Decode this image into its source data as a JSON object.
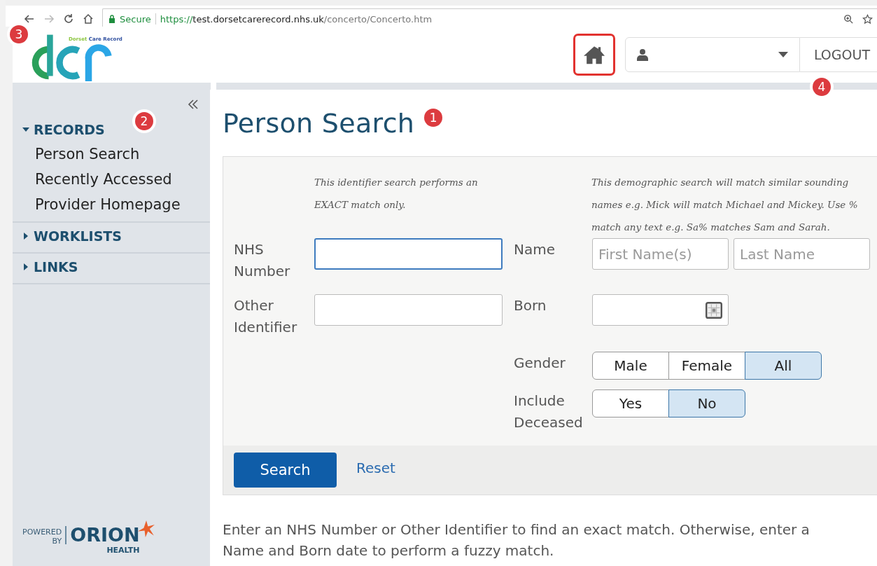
{
  "browser": {
    "secure_label": "Secure",
    "url_scheme": "https://",
    "url_host": "test.dorsetcarerecord.nhs.uk",
    "url_path": "/concerto/Concerto.htm"
  },
  "header": {
    "logo_words": [
      "Dorset",
      "Care Record"
    ],
    "logo_badge": "3",
    "logout": "LOGOUT",
    "logout_badge": "4"
  },
  "sidebar": {
    "badge": "2",
    "sections": [
      {
        "label": "RECORDS",
        "expanded": true,
        "items": [
          "Person Search",
          "Recently Accessed",
          "Provider Homepage"
        ]
      },
      {
        "label": "WORKLISTS",
        "expanded": false
      },
      {
        "label": "LINKS",
        "expanded": false
      }
    ],
    "powered_by": [
      "POWERED",
      "BY"
    ],
    "brand": "ORION",
    "brand_sub": "HEALTH"
  },
  "page": {
    "title": "Person Search",
    "title_badge": "1",
    "identifier_note": "This identifier search performs an\nEXACT match only.",
    "demographic_note": "This demographic search will match similar sounding\nnames e.g. Mick will match Michael and Mickey. Use %\nmatch any text e.g. Sa% matches Sam and Sarah.",
    "nhs_label": "NHS\nNumber",
    "other_label": "Other\nIdentifier",
    "name_label": "Name",
    "first_placeholder": "First Name(s)",
    "last_placeholder": "Last Name",
    "born_label": "Born",
    "gender_label": "Gender",
    "gender_options": [
      {
        "label": "Male",
        "selected": false
      },
      {
        "label": "Female",
        "selected": false
      },
      {
        "label": "All",
        "selected": true
      }
    ],
    "deceased_label": "Include\nDeceased",
    "deceased_options": [
      {
        "label": "Yes",
        "selected": false
      },
      {
        "label": "No",
        "selected": true
      }
    ],
    "search_button": "Search",
    "reset_link": "Reset",
    "help": "Enter an NHS Number or Other Identifier to find an exact match. Otherwise, enter a Name and Born date to perform a fuzzy match."
  }
}
